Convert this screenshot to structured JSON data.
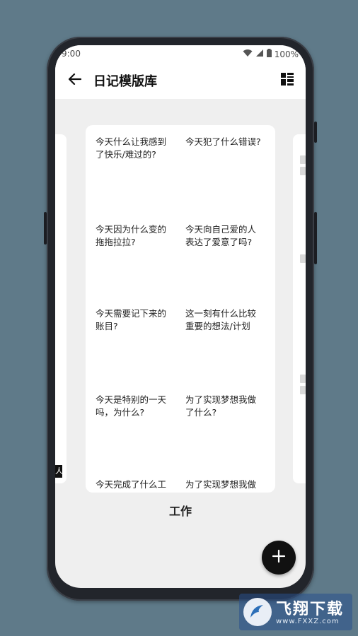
{
  "status_bar": {
    "time": "9:00",
    "battery": "100%"
  },
  "app_bar": {
    "title": "日记模版库"
  },
  "card": {
    "prompts": [
      "今天什么让我感到了快乐/难过的?",
      "今天犯了什么错误?",
      "今天因为什么变的拖拖拉拉?",
      "今天向自己爱的人表达了爱意了吗?",
      "今天需要记下来的账目?",
      "这一刻有什么比较重要的想法/计划",
      "今天是特别的一天吗，为什么?",
      "为了实现梦想我做了什么?",
      "今天完成了什么工作",
      "为了实现梦想我做了"
    ]
  },
  "card_label": "工作",
  "left_peek_tag": "人",
  "watermark": {
    "title": "飞翔下载",
    "url": "www.FXXZ.com"
  },
  "icons": {
    "back": "arrow-left-icon",
    "layout": "grid-layout-icon",
    "add": "plus-icon",
    "wifi": "wifi-icon",
    "signal": "signal-icon",
    "battery": "battery-icon"
  }
}
